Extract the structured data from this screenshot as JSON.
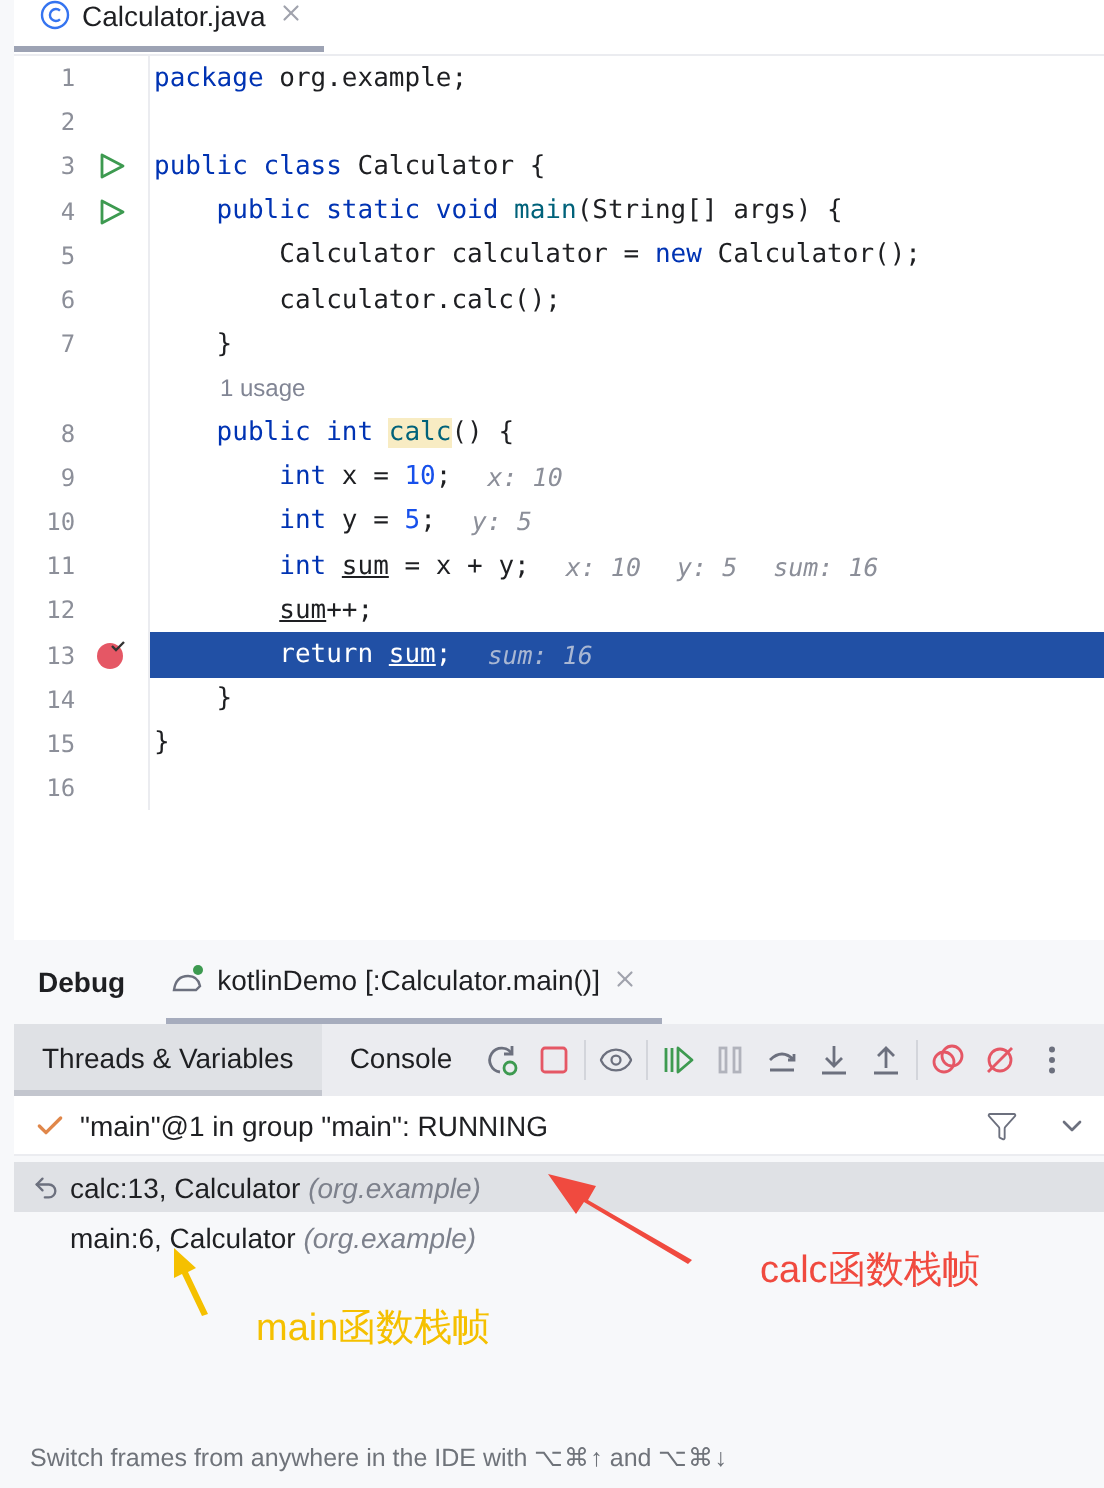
{
  "editor_tab": {
    "title": "Calculator.java",
    "selected": true
  },
  "lines": [
    {
      "kind": "code",
      "n": "1",
      "current": false,
      "tokens": [
        {
          "kind": "kw",
          "text": "package"
        },
        {
          "kind": "p",
          "text": " org.example;"
        }
      ]
    },
    {
      "kind": "code",
      "n": "2",
      "current": false
    },
    {
      "kind": "code",
      "n": "3",
      "gutter": {
        "kind": "run"
      },
      "current": false,
      "tokens": [
        {
          "kind": "kw",
          "text": "public class"
        },
        {
          "kind": "p",
          "text": " Calculator {"
        }
      ]
    },
    {
      "kind": "code",
      "n": "4",
      "gutter": {
        "kind": "run"
      },
      "current": false,
      "tokens": [
        {
          "kind": "kw",
          "text": "    public static void"
        },
        {
          "kind": "fn",
          "text": " main"
        },
        {
          "kind": "p",
          "text": "(String[] args) {"
        }
      ]
    },
    {
      "kind": "code",
      "n": "5",
      "current": false,
      "tokens": [
        {
          "kind": "p",
          "text": "        Calculator calculator = "
        },
        {
          "kind": "kw",
          "text": "new"
        },
        {
          "kind": "p",
          "text": " Calculator();"
        }
      ]
    },
    {
      "kind": "code",
      "n": "6",
      "current": false,
      "tokens": [
        {
          "kind": "p",
          "text": "        calculator.calc();"
        }
      ]
    },
    {
      "kind": "code",
      "n": "7",
      "current": false,
      "tokens": [
        {
          "kind": "p",
          "text": "    }"
        }
      ]
    },
    {
      "kind": "usage",
      "text": "1 usage"
    },
    {
      "kind": "code",
      "n": "8",
      "current": false,
      "tokens": [
        {
          "kind": "kw",
          "text": "    public int "
        },
        {
          "kind": "fnhl",
          "text": "calc"
        },
        {
          "kind": "p",
          "text": "() {"
        }
      ]
    },
    {
      "kind": "code",
      "n": "9",
      "current": false,
      "tokens": [
        {
          "kind": "kw",
          "text": "        int"
        },
        {
          "kind": "p",
          "text": " x = "
        },
        {
          "kind": "num",
          "text": "10"
        },
        {
          "kind": "p",
          "text": ";"
        }
      ],
      "hints": [
        "x: 10"
      ]
    },
    {
      "kind": "code",
      "n": "10",
      "current": false,
      "tokens": [
        {
          "kind": "kw",
          "text": "        int"
        },
        {
          "kind": "p",
          "text": " y = "
        },
        {
          "kind": "num",
          "text": "5"
        },
        {
          "kind": "p",
          "text": ";"
        }
      ],
      "hints": [
        "y: 5"
      ]
    },
    {
      "kind": "code",
      "n": "11",
      "current": false,
      "tokens": [
        {
          "kind": "kw",
          "text": "        int "
        },
        {
          "kind": "var",
          "text": "sum"
        },
        {
          "kind": "p",
          "text": " = x + y;"
        }
      ],
      "hints": [
        "x: 10",
        "y: 5",
        "sum: 16"
      ]
    },
    {
      "kind": "code",
      "n": "12",
      "current": false,
      "tokens": [
        {
          "kind": "var",
          "text": "        sum"
        },
        {
          "kind": "p",
          "text": "++;"
        }
      ]
    },
    {
      "kind": "code",
      "n": "13",
      "gutter": {
        "kind": "breakpoint"
      },
      "current": true,
      "tokens": [
        {
          "kind": "p",
          "text": "        return "
        },
        {
          "kind": "var",
          "text": "sum"
        },
        {
          "kind": "p",
          "text": ";"
        }
      ],
      "hints": [
        "sum: 16"
      ]
    },
    {
      "kind": "code",
      "n": "14",
      "current": false,
      "tokens": [
        {
          "kind": "p",
          "text": "    }"
        }
      ]
    },
    {
      "kind": "code",
      "n": "15",
      "current": false,
      "tokens": [
        {
          "kind": "p",
          "text": "}"
        }
      ]
    },
    {
      "kind": "code",
      "n": "16",
      "current": false
    }
  ],
  "debug": {
    "title": "Debug",
    "session_tab": {
      "label": "kotlinDemo [:Calculator.main()]",
      "selected": true
    },
    "tabs": [
      {
        "label": "Threads & Variables",
        "selected": true
      },
      {
        "label": "Console",
        "selected": false
      }
    ],
    "toolbar": [
      {
        "kind": "rerun",
        "disabled": false
      },
      {
        "kind": "stop",
        "disabled": false
      },
      {
        "kind": "sep"
      },
      {
        "kind": "watch",
        "disabled": false
      },
      {
        "kind": "sep"
      },
      {
        "kind": "resume",
        "disabled": false
      },
      {
        "kind": "pause",
        "disabled": true
      },
      {
        "kind": "step-over",
        "disabled": false
      },
      {
        "kind": "step-into",
        "disabled": false
      },
      {
        "kind": "step-out",
        "disabled": false
      },
      {
        "kind": "sep"
      },
      {
        "kind": "breakpoints",
        "disabled": false
      },
      {
        "kind": "mute",
        "disabled": false
      },
      {
        "kind": "more",
        "disabled": false
      }
    ],
    "thread": "\"main\"@1 in group \"main\": RUNNING",
    "frames": [
      {
        "method": "calc:13, Calculator",
        "package": "(org.example)",
        "selected": true
      },
      {
        "method": "main:6, Calculator",
        "package": "(org.example)",
        "selected": false
      }
    ],
    "hint": "Switch frames from anywhere in the IDE with ⌥⌘↑ and ⌥⌘↓"
  },
  "annotations": [
    {
      "text": "calc函数栈帧",
      "color": "#f04a3f"
    },
    {
      "text": "main函数栈帧",
      "color": "#f5c000"
    }
  ]
}
